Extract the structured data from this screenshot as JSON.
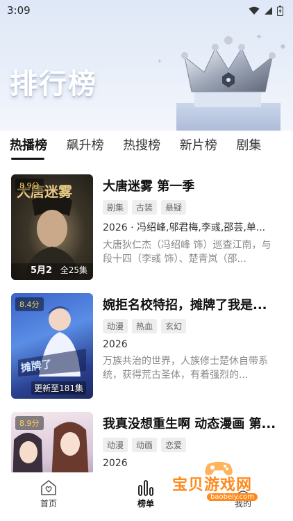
{
  "status_bar": {
    "time": "3:09"
  },
  "hero": {
    "title": "排行榜"
  },
  "tabs": [
    {
      "label": "热播榜",
      "active": true
    },
    {
      "label": "飙升榜",
      "active": false
    },
    {
      "label": "热搜榜",
      "active": false
    },
    {
      "label": "新片榜",
      "active": false
    },
    {
      "label": "剧集",
      "active": false
    }
  ],
  "items": [
    {
      "score": "8.9分",
      "poster_caption": "全25集",
      "poster_date": "5月2",
      "title": "大唐迷雾 第一季",
      "tags": [
        "剧集",
        "古装",
        "悬疑"
      ],
      "meta": "2026 · 冯绍峰,邬君梅,李彧,邵芸,单...",
      "desc": "大唐狄仁杰（冯绍峰 饰）巡查江南，与段十四（李彧 饰）、楚青岚（邵..."
    },
    {
      "score": "8.4分",
      "poster_caption": "更新至181集",
      "title": "婉拒名校特招，摊牌了我是...",
      "tags": [
        "动漫",
        "热血",
        "玄幻"
      ],
      "meta": "2026",
      "desc": "万族共治的世界，人族修士楚休自带系统，获得荒古圣体，有着强烈的..."
    },
    {
      "score": "8.9分",
      "title": "我真没想重生啊 动态漫画 第...",
      "tags": [
        "动漫",
        "动画",
        "恋爱"
      ],
      "meta": "2026",
      "desc": ""
    }
  ],
  "bottom_nav": [
    {
      "label": "首页",
      "icon": "home-icon",
      "active": false
    },
    {
      "label": "榜单",
      "icon": "chart-icon",
      "active": true
    },
    {
      "label": "我的",
      "icon": "user-icon",
      "active": false
    }
  ],
  "watermark": {
    "text": "宝贝游戏网",
    "url": "baobeiy.com"
  }
}
